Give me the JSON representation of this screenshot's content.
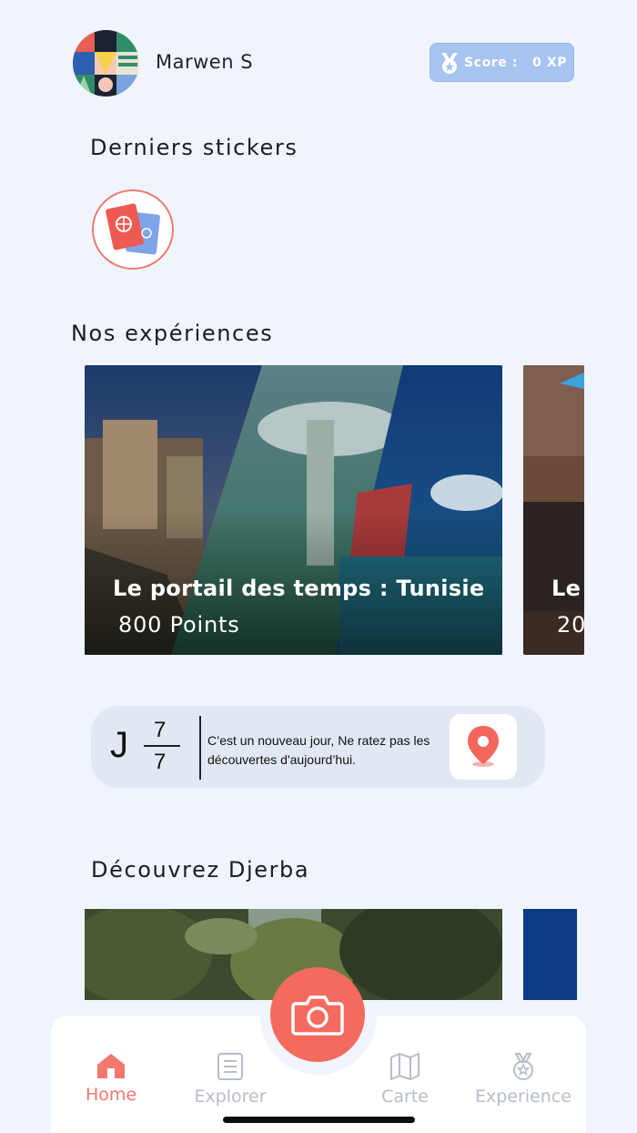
{
  "header": {
    "username": "Marwen S",
    "score_label": "Score :",
    "score_value": "0 XP"
  },
  "stickers": {
    "title": "Derniers stickers"
  },
  "experiences": {
    "title": "Nos expériences",
    "cards": [
      {
        "title": "Le portail des temps : Tunisie",
        "points": "800 Points"
      },
      {
        "title": "Le v",
        "points": "20"
      }
    ]
  },
  "day_banner": {
    "letter": "J",
    "numerator": "7",
    "denominator": "7",
    "message": "C’est un nouveau jour, Ne ratez pas les découvertes d'aujourd’hui."
  },
  "discover": {
    "title": "Découvrez Djerba"
  },
  "nav": {
    "items": [
      {
        "label": "Home",
        "icon": "home-icon",
        "active": true
      },
      {
        "label": "Explorer",
        "icon": "list-icon"
      },
      {
        "label": "Carte",
        "icon": "map-icon"
      },
      {
        "label": "Experience",
        "icon": "medal-icon"
      }
    ],
    "camera_icon": "camera-icon"
  },
  "colors": {
    "background": "#eff4fd",
    "accent": "#f56a5e",
    "score_pill": "#a7c3ef",
    "nav_inactive": "#b7bdc9"
  }
}
